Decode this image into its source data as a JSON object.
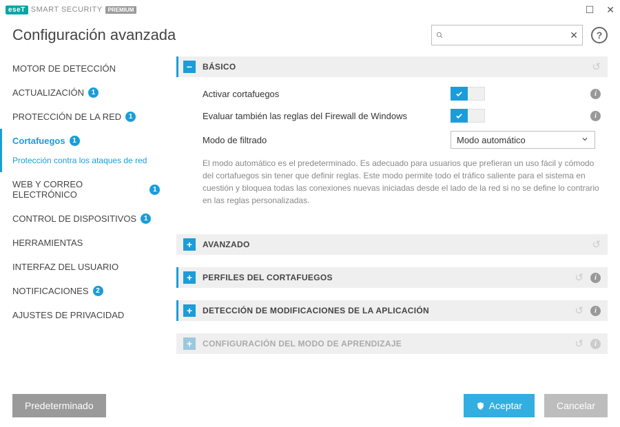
{
  "window": {
    "brand": "eseT",
    "product": "SMART SECURITY",
    "edition": "PREMIUM"
  },
  "header": {
    "title": "Configuración avanzada",
    "search_placeholder": ""
  },
  "sidebar": {
    "items": [
      {
        "label": "MOTOR DE DETECCIÓN",
        "badge": null
      },
      {
        "label": "ACTUALIZACIÓN",
        "badge": "1"
      },
      {
        "label": "PROTECCIÓN DE LA RED",
        "badge": "1"
      },
      {
        "label": "Cortafuegos",
        "badge": "1",
        "active": true
      },
      {
        "sublabel": "Protección contra los ataques de red"
      },
      {
        "label": "WEB Y CORREO ELECTRÓNICO",
        "badge": "1"
      },
      {
        "label": "CONTROL DE DISPOSITIVOS",
        "badge": "1"
      },
      {
        "label": "HERRAMIENTAS",
        "badge": null
      },
      {
        "label": "INTERFAZ DEL USUARIO",
        "badge": null
      },
      {
        "label": "NOTIFICACIONES",
        "badge": "2"
      },
      {
        "label": "AJUSTES DE PRIVACIDAD",
        "badge": null
      }
    ]
  },
  "sections": {
    "basic": {
      "title": "BÁSICO",
      "row1_label": "Activar cortafuegos",
      "row2_label": "Evaluar también las reglas del Firewall de Windows",
      "row3_label": "Modo de filtrado",
      "select_value": "Modo automático",
      "description": "El modo automático es el predeterminado. Es adecuado para usuarios que prefieran un uso fácil y cómodo del cortafuegos sin tener que definir reglas. Este modo permite todo el tráfico saliente para el sistema en cuestión y bloquea todas las conexiones nuevas iniciadas desde el lado de la red si no se define lo contrario en las reglas personalizadas."
    },
    "advanced": {
      "title": "AVANZADO"
    },
    "profiles": {
      "title": "PERFILES DEL CORTAFUEGOS"
    },
    "appmod": {
      "title": "DETECCIÓN DE MODIFICACIONES DE LA APLICACIÓN"
    },
    "learning": {
      "title": "CONFIGURACIÓN DEL MODO DE APRENDIZAJE"
    }
  },
  "footer": {
    "default": "Predeterminado",
    "accept": "Aceptar",
    "cancel": "Cancelar"
  }
}
